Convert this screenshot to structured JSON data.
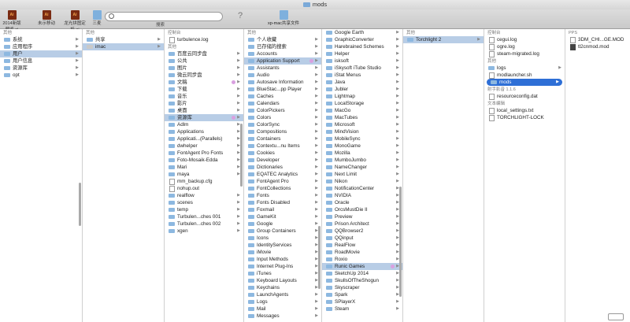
{
  "window": {
    "title": "mods"
  },
  "toolbar": {
    "items": [
      {
        "label": "2014新版预览.ai",
        "icon": "ai-file-icon"
      },
      {
        "label": "未示移动",
        "icon": "ai-file-icon"
      },
      {
        "label": "龙光拼图定析.ai",
        "icon": "ai-file-icon"
      },
      {
        "label": "三麦",
        "icon": "folder-icon"
      }
    ],
    "search_placeholder": "",
    "search_label": "搜索",
    "help": "?",
    "share_label": "xp-mac共享文件"
  },
  "col1": {
    "section": "其他",
    "items": [
      "系统",
      "应用程序",
      "用户",
      "用户信息",
      "资源库",
      "opt"
    ]
  },
  "col2": {
    "section": "其他",
    "items": [
      "共享",
      "imac"
    ]
  },
  "col3": {
    "section_top": "控制台",
    "top_items": [
      "turbulence.log"
    ],
    "section": "其他",
    "items": [
      "百度云同步盘",
      "公共",
      "图片",
      "微云同步盘",
      "文稿",
      "下载",
      "音乐",
      "影片",
      "桌面",
      "资源库",
      "Adlm",
      "Applications",
      "Applicati...(Parallels)",
      "dwhelper",
      "FontAgent Pro Fonts",
      "Foto-Mosaik-Edda",
      "Mari",
      "maya",
      "mm_backup.cfg",
      "nohup.out",
      "realflow",
      "scenes",
      "temp",
      "Turbulen...ches 001",
      "Turbulen...ches 002",
      "xgen"
    ]
  },
  "col4": {
    "section": "其他",
    "items": [
      "个人收藏",
      "已存储的搜索",
      "Accounts",
      "Application Support",
      "Assistants",
      "Audio",
      "Autosave Information",
      "BlueStac...pp Player",
      "Caches",
      "Calendars",
      "ColorPickers",
      "Colors",
      "ColorSync",
      "Compositions",
      "Containers",
      "Contextu...nu Items",
      "Cookies",
      "Developer",
      "Dictionaries",
      "EQATEC Analytics",
      "FontAgent Pro",
      "FontCollections",
      "Fonts",
      "Fonts Disabled",
      "Foxmail",
      "GameKit",
      "Google",
      "Group Containers",
      "Icons",
      "IdentityServices",
      "iMovie",
      "Input Methods",
      "Internet Plug-Ins",
      "iTunes",
      "Keyboard Layouts",
      "Keychains",
      "LaunchAgents",
      "Logs",
      "Mail",
      "Messages"
    ]
  },
  "col5": {
    "items": [
      "Google Earth",
      "GraphicConverter",
      "Harebrained Schemes",
      "Helper",
      "isksoft",
      "iSkysoft iTube Studio",
      "iStat Menus",
      "Java",
      "Jubler",
      "Lightmap",
      "LocalStorage",
      "MacGo",
      "MacTubes",
      "Microsoft",
      "MindVision",
      "MobileSync",
      "MonoGame",
      "Mozilla",
      "MumboJumbo",
      "NameChanger",
      "Next Limit",
      "Nikon",
      "NotificationCenter",
      "NVIDIA",
      "Oracle",
      "OrcsMustDie II",
      "Preview",
      "Prison Architect",
      "QQBrowser2",
      "QQinput",
      "RealFlow",
      "RoadMovie",
      "Roxio",
      "Runic Games",
      "SketchUp 2014",
      "SkullsOfTheShogun",
      "Skyscraper",
      "Spark",
      "SPlayerX",
      "Steam"
    ]
  },
  "col6": {
    "section": "其他",
    "items": [
      "Torchlight 2"
    ]
  },
  "col7": {
    "section": "控制台",
    "top_files": [
      "cegui.log",
      "ogre.log",
      "steam-migrated.log"
    ],
    "section2": "其他",
    "items": [
      "logs",
      "modlauncher.sh",
      "mods"
    ],
    "section3": "射手影音 1.1.6",
    "files3": [
      "resourceconfig.dat"
    ],
    "section4": "文本编辑",
    "files4": [
      "local_settings.txt",
      "TORCHLIGHT-LOCK"
    ]
  },
  "col8": {
    "section": "PPS",
    "items": [
      "3DM_CHI...GE.MOD",
      "tl2cnmod.mod"
    ]
  }
}
